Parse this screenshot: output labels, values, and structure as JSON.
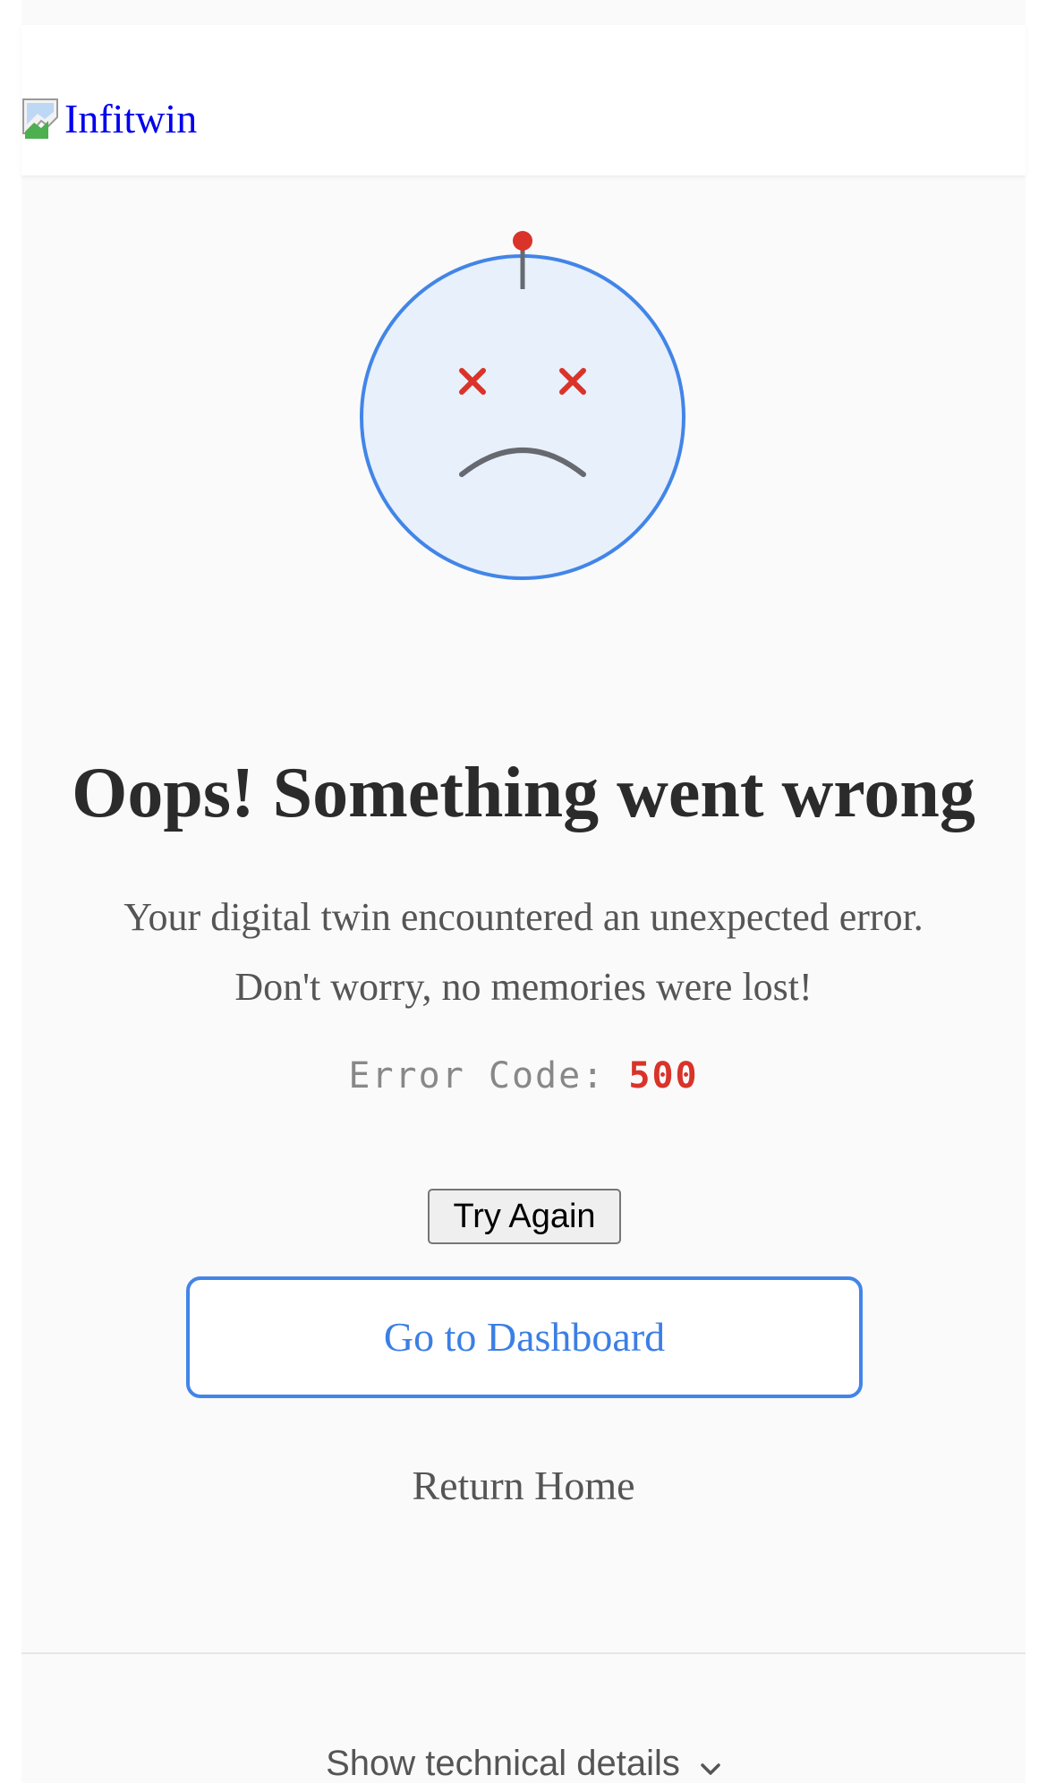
{
  "header": {
    "logo_alt": "Infitwin"
  },
  "error": {
    "title": "Oops! Something went wrong",
    "message_line1": "Your digital twin encountered an unexpected error.",
    "message_line2": "Don't worry, no memories were lost!",
    "code_label": "Error Code:",
    "code_value": "500"
  },
  "actions": {
    "try_again": "Try Again",
    "dashboard": "Go to Dashboard",
    "home": "Return Home"
  },
  "details": {
    "toggle_label": "Show technical details"
  },
  "colors": {
    "accent_blue": "#4285e8",
    "error_red": "#d9332a",
    "face_fill": "#e8f0fc",
    "text_dark": "#2b2b2b",
    "text_muted": "#555555"
  },
  "icons": {
    "broken_image": "broken-image-icon",
    "face": "sad-face-icon",
    "chevron": "chevron-down-icon"
  }
}
